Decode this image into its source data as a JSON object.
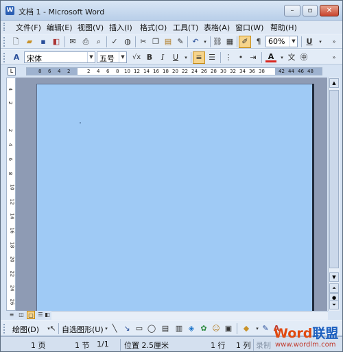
{
  "window": {
    "title": "文档 1 - Microsoft Word",
    "app_icon_glyph": "W",
    "minimize_glyph": "–",
    "restore_glyph": "▫",
    "close_glyph": "✕"
  },
  "menu": {
    "items": [
      "文件(F)",
      "编辑(E)",
      "视图(V)",
      "插入(I)",
      "格式(O)",
      "工具(T)",
      "表格(A)",
      "窗口(W)",
      "帮助(H)"
    ]
  },
  "toolbar_standard": {
    "zoom": "60%",
    "help_label": "U",
    "icons": [
      "new-icon",
      "open-icon",
      "save-icon",
      "permission-icon",
      "email-icon",
      "print-icon",
      "print-preview-icon",
      "spelling-icon",
      "research-icon",
      "cut-icon",
      "copy-icon",
      "paste-icon",
      "format-painter-icon",
      "undo-icon",
      "hyperlink-icon",
      "tables-icon",
      "drawing-icon",
      "show-hide-icon"
    ]
  },
  "toolbar_formatting": {
    "style_glyph": "A",
    "font": "宋体",
    "size": "五号",
    "bold": "B",
    "italic": "I",
    "underline": "U",
    "font_color_label": "A"
  },
  "ruler": {
    "corner_glyph": "L",
    "h_ticks": [
      "8",
      "6",
      "4",
      "2",
      "2",
      "4",
      "6",
      "8",
      "10",
      "12",
      "14",
      "16",
      "18",
      "20",
      "22",
      "24",
      "26",
      "28",
      "30",
      "32",
      "34",
      "36",
      "38",
      "42",
      "44",
      "46",
      "48"
    ],
    "v_ticks": [
      "4",
      "2",
      "2",
      "4",
      "6",
      "8",
      "10",
      "12",
      "14",
      "16",
      "18",
      "20",
      "22",
      "24",
      "26"
    ]
  },
  "drawing_toolbar": {
    "draw_label": "绘图(D)",
    "autoshapes_label": "自选图形(U)"
  },
  "status_bar": {
    "page": "1 页",
    "section": "1 节",
    "page_of": "1/1",
    "position": "位置 2.5厘米",
    "line": "1 行",
    "column": "1 列",
    "record": "录制"
  },
  "watermark": {
    "logo_word": "Word",
    "logo_cn": "联盟",
    "url": "www.wordlm.com"
  },
  "colors": {
    "page": "#9fcaf5",
    "chrome": "#d6e3f3",
    "logo_orange": "#e04a10",
    "logo_blue": "#1c5fbf"
  }
}
